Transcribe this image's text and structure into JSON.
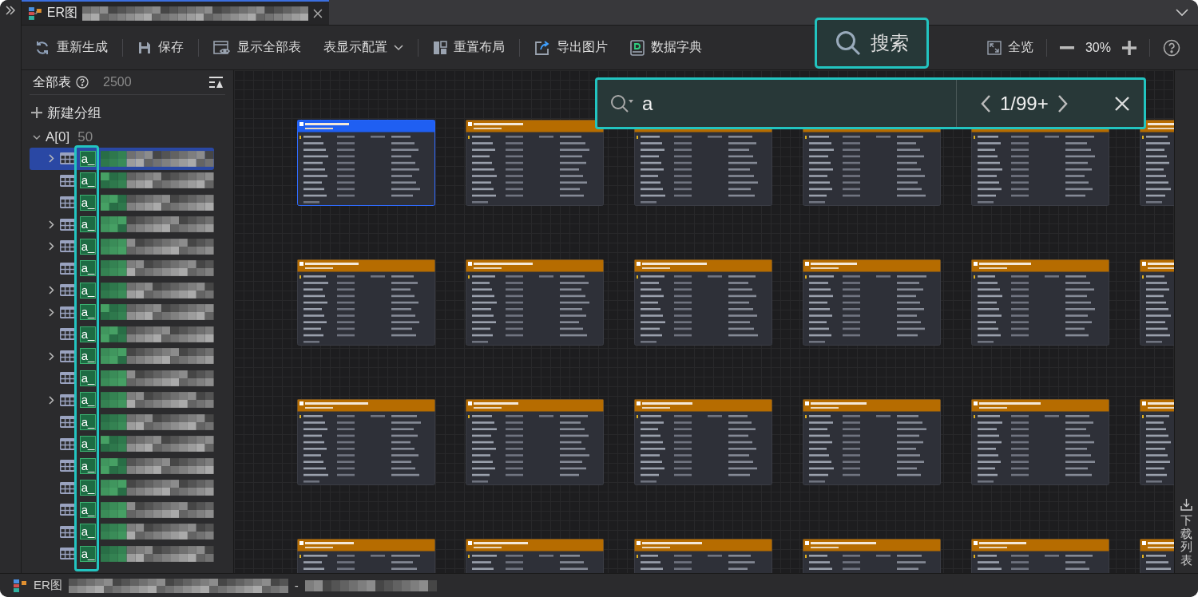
{
  "tab": {
    "title": "ER图",
    "closable": true
  },
  "toolbar": {
    "groups": [
      [
        {
          "label": "重新生成",
          "dropdown": false
        }
      ],
      [
        {
          "label": "保存",
          "dropdown": false
        }
      ],
      [
        {
          "label": "显示全部表",
          "dropdown": false
        },
        {
          "label": "表显示配置",
          "dropdown": true
        }
      ],
      [
        {
          "label": "重置布局",
          "dropdown": false
        }
      ],
      [
        {
          "label": "导出图片",
          "dropdown": false
        },
        {
          "label": "数据字典",
          "dropdown": false
        }
      ]
    ],
    "search_button": {
      "label": "搜索",
      "highlighted": true
    },
    "fit": "全览",
    "zoom_text": "30%"
  },
  "sidebar": {
    "title": "全部表",
    "count": "2500",
    "new_group": "新建分组",
    "group": {
      "name": "A[0]",
      "count": "50",
      "expanded": true,
      "match_column_highlighted": true,
      "items": [
        {
          "prefix": "a_",
          "expandable": true,
          "selected": true
        },
        {
          "prefix": "a_",
          "expandable": false,
          "selected": false
        },
        {
          "prefix": "a_",
          "expandable": false,
          "selected": false
        },
        {
          "prefix": "a_",
          "expandable": true,
          "selected": false
        },
        {
          "prefix": "a_",
          "expandable": true,
          "selected": false
        },
        {
          "prefix": "a_",
          "expandable": false,
          "selected": false
        },
        {
          "prefix": "a_",
          "expandable": true,
          "selected": false
        },
        {
          "prefix": "a_",
          "expandable": true,
          "selected": false
        },
        {
          "prefix": "a_",
          "expandable": false,
          "selected": false
        },
        {
          "prefix": "a_",
          "expandable": true,
          "selected": false
        },
        {
          "prefix": "a_",
          "expandable": false,
          "selected": false
        },
        {
          "prefix": "a_",
          "expandable": true,
          "selected": false
        },
        {
          "prefix": "a_",
          "expandable": false,
          "selected": false
        },
        {
          "prefix": "a_",
          "expandable": false,
          "selected": false
        },
        {
          "prefix": "a_",
          "expandable": false,
          "selected": false
        },
        {
          "prefix": "a_",
          "expandable": false,
          "selected": false
        },
        {
          "prefix": "a_",
          "expandable": false,
          "selected": false
        },
        {
          "prefix": "a_",
          "expandable": false,
          "selected": false
        },
        {
          "prefix": "a_",
          "expandable": false,
          "selected": false
        }
      ]
    }
  },
  "search": {
    "value": "a",
    "counter": "1/99+",
    "highlighted": true
  },
  "table_cards": [
    {
      "selected": true
    },
    {
      "selected": false
    },
    {
      "selected": false
    },
    {
      "selected": false
    },
    {
      "selected": false
    },
    {
      "selected": false
    },
    {
      "selected": false
    },
    {
      "selected": false
    },
    {
      "selected": false
    },
    {
      "selected": false
    },
    {
      "selected": false
    },
    {
      "selected": false
    },
    {
      "selected": false
    },
    {
      "selected": false
    },
    {
      "selected": false
    },
    {
      "selected": false
    },
    {
      "selected": false
    },
    {
      "selected": false
    },
    {
      "selected": false
    },
    {
      "selected": false
    },
    {
      "selected": false
    },
    {
      "selected": false
    },
    {
      "selected": false
    },
    {
      "selected": false
    }
  ],
  "download_panel": {
    "label": "下载列表"
  },
  "status_bar": {
    "title": "ER图",
    "separator": "-"
  }
}
